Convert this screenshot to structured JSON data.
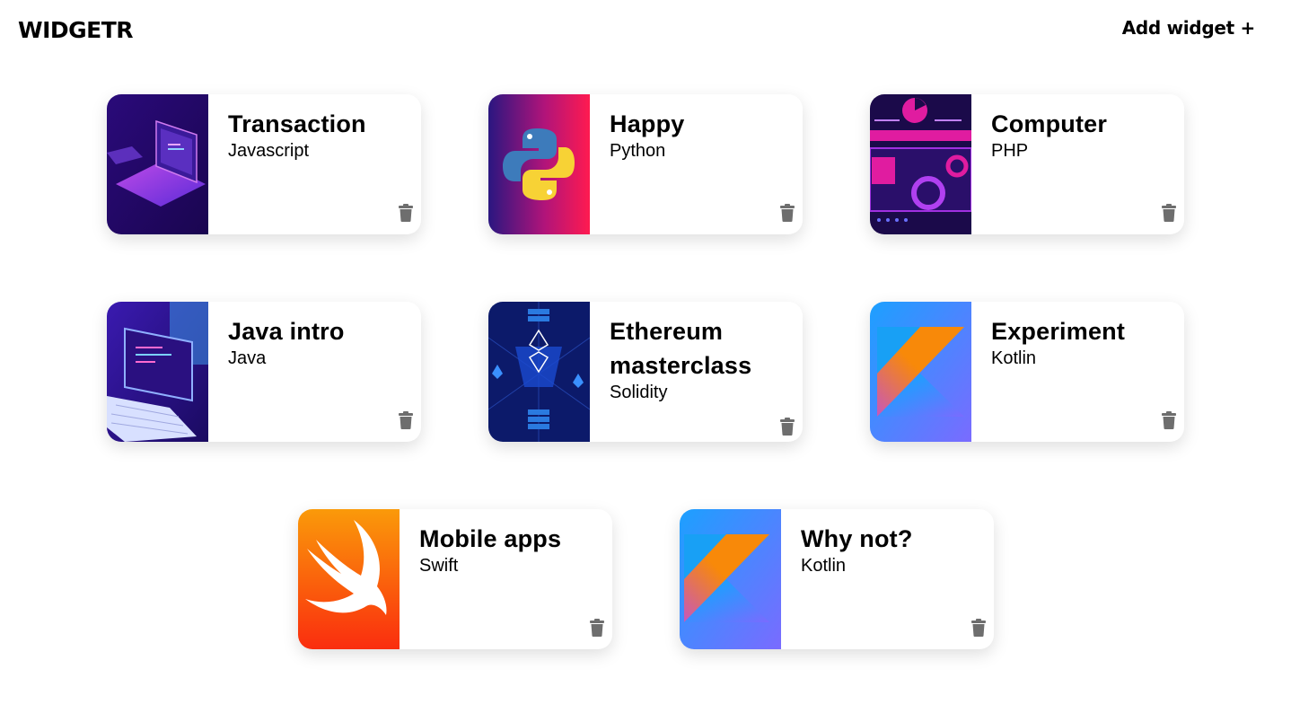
{
  "header": {
    "logo": "WIDGETR",
    "add_widget_label": "Add widget +"
  },
  "widgets": [
    {
      "title": "Transaction",
      "language": "Javascript",
      "image": "laptop-illustration"
    },
    {
      "title": "Happy",
      "language": "Python",
      "image": "python-logo"
    },
    {
      "title": "Computer",
      "language": "PHP",
      "image": "code-gears-illustration"
    },
    {
      "title": "Java intro",
      "language": "Java",
      "image": "laptop-code-illustration"
    },
    {
      "title": "Ethereum masterclass",
      "language": "Solidity",
      "image": "ethereum-blockchain-illustration"
    },
    {
      "title": "Experiment",
      "language": "Kotlin",
      "image": "kotlin-logo"
    },
    {
      "title": "Mobile apps",
      "language": "Swift",
      "image": "swift-logo"
    },
    {
      "title": "Why not?",
      "language": "Kotlin",
      "image": "kotlin-logo"
    }
  ],
  "icons": {
    "delete": "trash-icon"
  },
  "colors": {
    "background": "#ffffff",
    "text": "#000000",
    "trash": "#6e6e6e"
  }
}
